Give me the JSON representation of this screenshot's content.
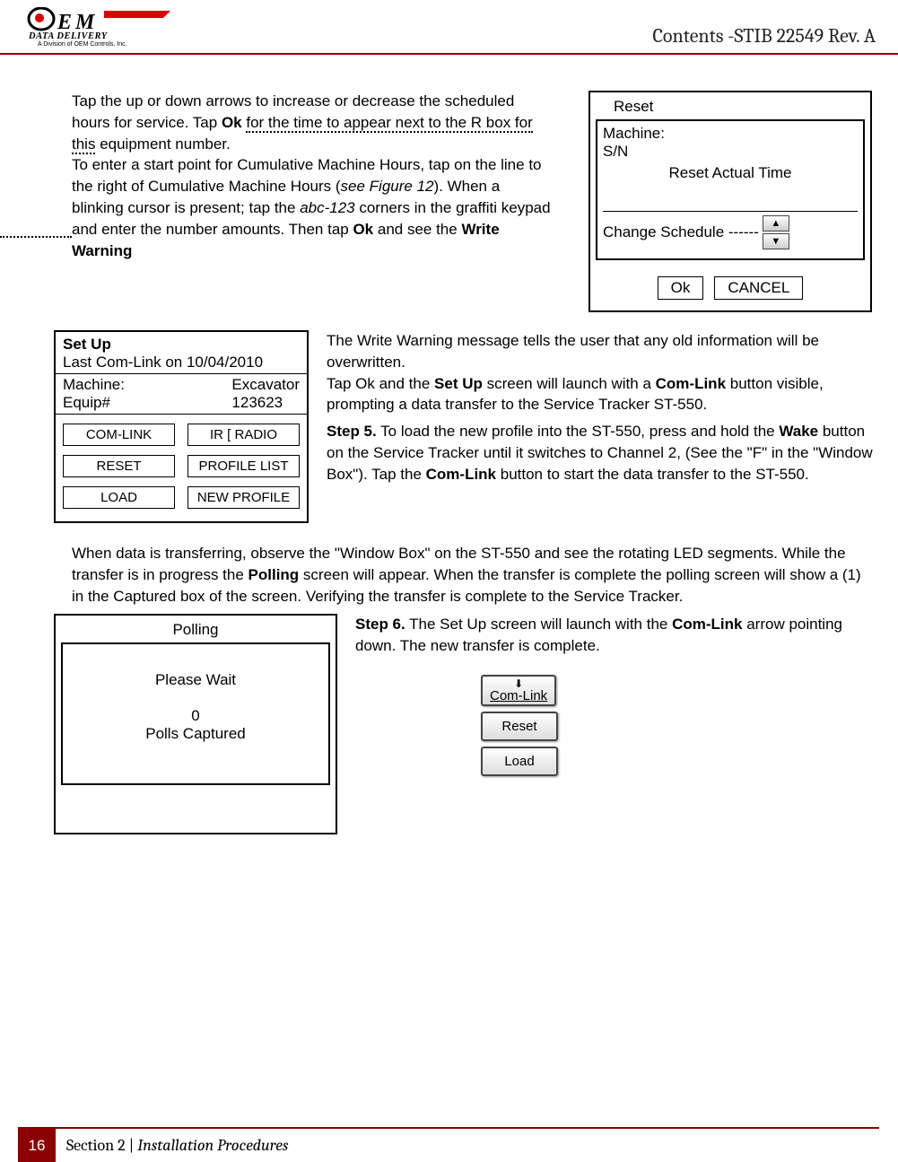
{
  "header": {
    "logo_top": "OEM",
    "logo_mid": "DATA DELIVERY",
    "logo_sub": "A Division of OEM Controls, Inc.",
    "title": "Contents -STIB 22549 Rev. A"
  },
  "para1": {
    "t1a": "Tap the up or down arrows to increase or decrease the scheduled hours for service. Tap ",
    "t1b": "Ok",
    "t1c": " ",
    "dotted": "for the time to appear next to the R box for this",
    "t2": " equipment number.",
    "t3a": "To enter a start point for Cumulative Machine Hours, tap on the line to the right of Cumulative Machine Hours (",
    "t3b": "see Figure 12",
    "t3c": "). When a blinking cursor is present; tap the ",
    "t3d": "abc-123",
    "t3e": " corners in the graffiti keypad and enter the number amounts. Then tap ",
    "t3f": "Ok",
    "t3g": " and see the ",
    "t3h": "Write Warning"
  },
  "reset": {
    "title": "Reset",
    "machine": "Machine:",
    "sn": "S/N",
    "actual": "Reset Actual Time",
    "change": "Change Schedule ------",
    "ok": "Ok",
    "cancel": "CANCEL"
  },
  "setup": {
    "title": "Set Up",
    "last": "Last Com-Link on 10/04/2010",
    "machine_l": "Machine:",
    "machine_r": "Excavator",
    "equip_l": "Equip#",
    "equip_r": "123623",
    "b1": "COM-LINK",
    "b2": "IR [ RADIO",
    "b3": "RESET",
    "b4": "PROFILE LIST",
    "b5": "LOAD",
    "b6": "NEW PROFILE"
  },
  "para2": {
    "p1a": "The Write Warning message tells the user that any old information will be overwritten.",
    "p1b1": "Tap Ok and the ",
    "p1b2": "Set Up",
    "p1b3": " screen will launch with a ",
    "p1b4": "Com-Link",
    "p1b5": " button visible, prompting a data transfer to the Service Tracker ST-550.",
    "p2a": "Step 5.",
    "p2b": " To load the new profile into the ST-550, press and hold the ",
    "p2c": "Wake",
    "p2d": " button on the Service Tracker until it switches to Channel 2, (See the \"F\" in the \"Window Box\"). Tap the ",
    "p2e": "Com-Link",
    "p2f": " button to start the data transfer to the ST-550."
  },
  "para3": {
    "a": "When data is transferring, observe the \"Window Box\" on the ST-550 and see the rotating LED segments. While the transfer is in progress the ",
    "b": "Polling",
    "c": " screen will appear. When the transfer is complete the polling screen will show a (1) in the Captured box of the screen. Verifying the transfer is complete to the Service Tracker."
  },
  "polling": {
    "title": "Polling",
    "wait": "Please Wait",
    "zero": "0",
    "pc": "Polls  Captured"
  },
  "step6": {
    "a": "Step 6.",
    "b": " The Set Up screen will launch with the ",
    "c": "Com-Link",
    "d": " arrow pointing down. The new transfer is complete.",
    "btn1a": "⬇",
    "btn1": "Com-Link",
    "btn2": "Reset",
    "btn3": "Load"
  },
  "footer": {
    "page": "16",
    "section": "Section 2 | ",
    "title": "Installation Procedures"
  }
}
